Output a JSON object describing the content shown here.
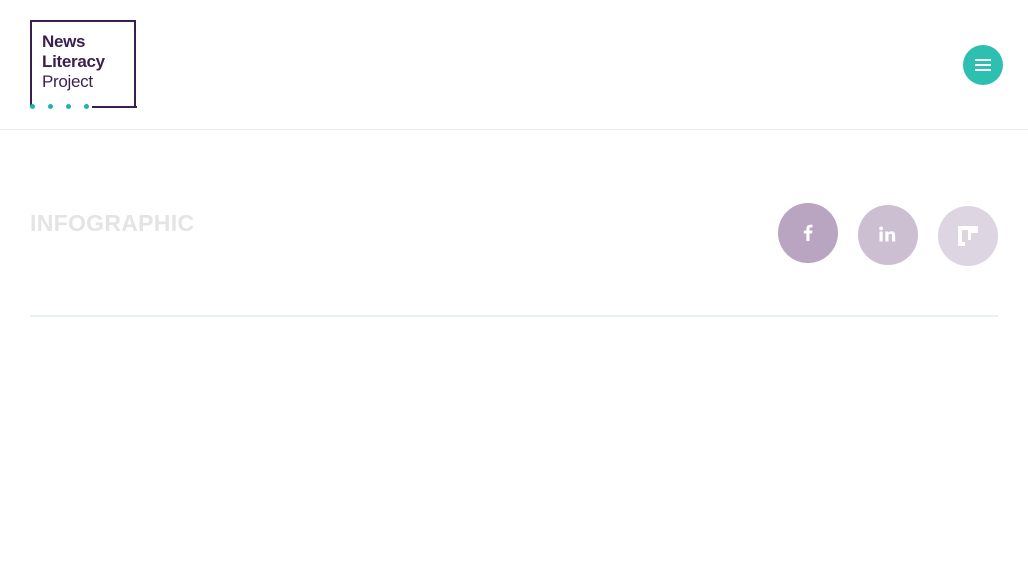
{
  "header": {
    "logo": {
      "lines": [
        "News",
        "Literacy",
        "Project"
      ],
      "accent_color": "#1fb5a8",
      "text_color": "#3b1f4f"
    },
    "menu_button": {
      "icon": "hamburger-icon",
      "color": "#2dbfb0"
    }
  },
  "main": {
    "eyebrow": "INFOGRAPHIC",
    "share_buttons": [
      {
        "network": "facebook",
        "icon": "facebook-icon",
        "color": "#b9a5c2"
      },
      {
        "network": "linkedin",
        "icon": "linkedin-icon",
        "color": "#cbbfd1"
      },
      {
        "network": "flipboard",
        "icon": "flipboard-icon",
        "color": "#ddd5e1"
      }
    ]
  }
}
